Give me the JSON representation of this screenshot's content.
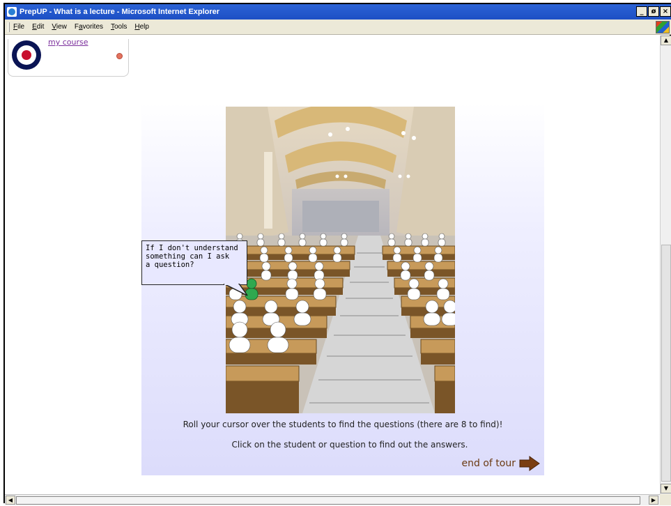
{
  "window": {
    "title": "PrepUP - What is a lecture - Microsoft Internet Explorer",
    "controls": [
      "_",
      "ø",
      "×"
    ]
  },
  "menu": {
    "items": [
      {
        "first": "F",
        "rest": "ile"
      },
      {
        "first": "E",
        "rest": "dit"
      },
      {
        "first": "V",
        "rest": "iew"
      },
      {
        "first": "a",
        "prefix": "F",
        "rest": "vorites"
      },
      {
        "first": "T",
        "rest": "ools"
      },
      {
        "first": "H",
        "rest": "elp"
      }
    ]
  },
  "course": {
    "link_label": "my course",
    "colors": {
      "outer": "#0a1454",
      "inner": "#ffffff",
      "center": "#c8102e"
    }
  },
  "callout": {
    "text": "If I don't understand\nsomething can I ask\na question?"
  },
  "instructions": {
    "line1": "Roll your cursor over the students to find the questions (there are 8 to find)!",
    "line2": "Click on the student or question to find out the answers."
  },
  "end_tour": {
    "label": "end of tour",
    "icon": "arrow-right-icon"
  },
  "colors": {
    "titlebar": "#2b63d6",
    "link": "#7b2f9c",
    "end_tour": "#6b3a12",
    "highlighted_student": "#2fa84f"
  }
}
